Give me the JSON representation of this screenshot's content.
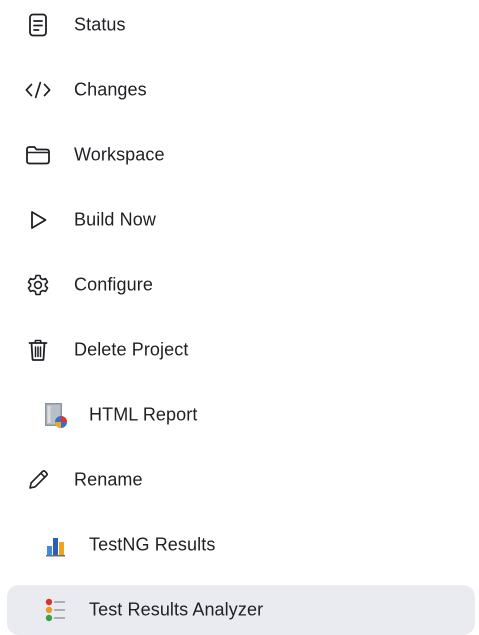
{
  "sidebar": {
    "items": [
      {
        "label": "Status",
        "icon": "status-icon"
      },
      {
        "label": "Changes",
        "icon": "code-icon"
      },
      {
        "label": "Workspace",
        "icon": "folder-icon"
      },
      {
        "label": "Build Now",
        "icon": "play-icon"
      },
      {
        "label": "Configure",
        "icon": "gear-icon"
      },
      {
        "label": "Delete Project",
        "icon": "trash-icon"
      },
      {
        "label": "HTML Report",
        "icon": "html-report-icon"
      },
      {
        "label": "Rename",
        "icon": "pencil-icon"
      },
      {
        "label": "TestNG Results",
        "icon": "bar-chart-icon"
      },
      {
        "label": "Test Results Analyzer",
        "icon": "test-results-analyzer-icon",
        "active": true
      }
    ]
  },
  "colors": {
    "text": "#1f1f24",
    "active_background": "#e9ebf1"
  }
}
